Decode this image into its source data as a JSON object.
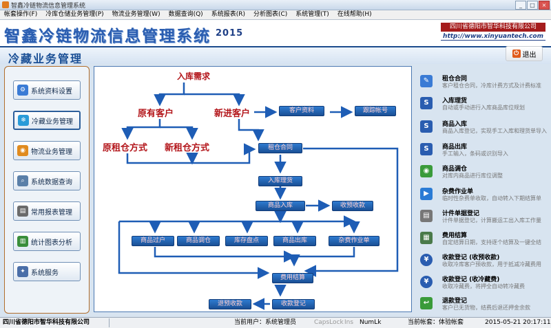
{
  "window": {
    "title": "智鑫冷链物流信息管理系统"
  },
  "menu": [
    "帐套操作(F)",
    "冷库仓储业务管理(P)",
    "物流业务管理(W)",
    "数据查询(Q)",
    "系统报表(R)",
    "分析图表(C)",
    "系统管理(T)",
    "在线帮助(H)"
  ],
  "banner": {
    "title": "智鑫冷链物流信息管理系统",
    "year": "2015",
    "company": "四川省德阳市智华科技有限公司",
    "url": "http://www.xinyuantech.com"
  },
  "module": {
    "title": "冷藏业务管理",
    "exit_label": "退出"
  },
  "sidebar": [
    {
      "label": "系统资料设置",
      "icon": "gear-icon",
      "color": "#3a7bd5"
    },
    {
      "label": "冷藏业务管理",
      "icon": "snowflake-icon",
      "color": "#2a9bd8"
    },
    {
      "label": "物流业务管理",
      "icon": "globe-icon",
      "color": "#e08b1f"
    },
    {
      "label": "系统数据查询",
      "icon": "search-icon",
      "color": "#5a7fa8"
    },
    {
      "label": "常用报表管理",
      "icon": "printer-icon",
      "color": "#6b6b6b"
    },
    {
      "label": "统计图表分析",
      "icon": "chart-icon",
      "color": "#3a8e3a"
    },
    {
      "label": "系统服务",
      "icon": "wrench-icon",
      "color": "#4a6ea8"
    }
  ],
  "flow": {
    "rk_demand": "入库需求",
    "old_client": "原有客户",
    "new_client": "新进客户",
    "client_info": "客户资料",
    "followup": "跟踪帐号",
    "orig_rent": "原租仓方式",
    "new_rent": "新租仓方式",
    "lease_contract": "租仓合同",
    "inbound_process": "入库理货",
    "goods_in": "商品入库",
    "advance_charge": "收预收款",
    "transfer": "商品过户",
    "relocate": "商品调仓",
    "inventory": "库存盘点",
    "goods_out": "商品出库",
    "misc_ops": "杂费作业单",
    "settle": "费用结算",
    "refund": "退预收款",
    "payment": "收款登记"
  },
  "right_items": [
    {
      "title": "租仓合同",
      "desc": "客户租仓合同，冷库计费方式及计费标准",
      "icon": "contract-icon",
      "color": "#3a7bd5"
    },
    {
      "title": "入库理货",
      "desc": "自动或手动进行入库商品库位规划",
      "icon": "s-icon",
      "color": "#2a5db0"
    },
    {
      "title": "商品入库",
      "desc": "商品入库登记，实现手工入库和理货单导入",
      "icon": "s-icon",
      "color": "#2a5db0"
    },
    {
      "title": "商品出库",
      "desc": "手工输入，条码或识别导入",
      "icon": "s-icon",
      "color": "#2a5db0"
    },
    {
      "title": "商品调仓",
      "desc": "对库内商品进行库位调整",
      "icon": "globe-icon",
      "color": "#3a9b3a"
    },
    {
      "title": "杂费作业单",
      "desc": "临时性杂费单收取，自动转入下期结算单",
      "icon": "truck-icon",
      "color": "#2a7bd5"
    },
    {
      "title": "计件单据登记",
      "desc": "计件单据登记，计算搬运工出入库工作量",
      "icon": "document-icon",
      "color": "#777777"
    },
    {
      "title": "费用结算",
      "desc": "自定结算日期，支持逐个结算及一键全结",
      "icon": "calculator-icon",
      "color": "#4a7a4a"
    },
    {
      "title": "收款登记 (收预收款)",
      "desc": "收取冷库客户预收款，用于抵减冷藏费用",
      "icon": "yen-icon",
      "color": "#2a5db0"
    },
    {
      "title": "收款登记 (收冷藏费)",
      "desc": "收取冷藏费，将押全自动转冷藏费",
      "icon": "yen-icon",
      "color": "#2a5db0"
    },
    {
      "title": "退款登记",
      "desc": "客户已无货物，结费后退还押金余款",
      "icon": "refund-icon",
      "color": "#3a9b3a"
    }
  ],
  "status": {
    "company": "四川省德阳市智华科技有限公司",
    "user": "当前用户：系统管理员",
    "caps": "CapsLock",
    "ins": "Ins",
    "num": "NumLk",
    "account": "当前帐套：体验帐套",
    "datetime": "2015-05-21  20:17:11"
  }
}
